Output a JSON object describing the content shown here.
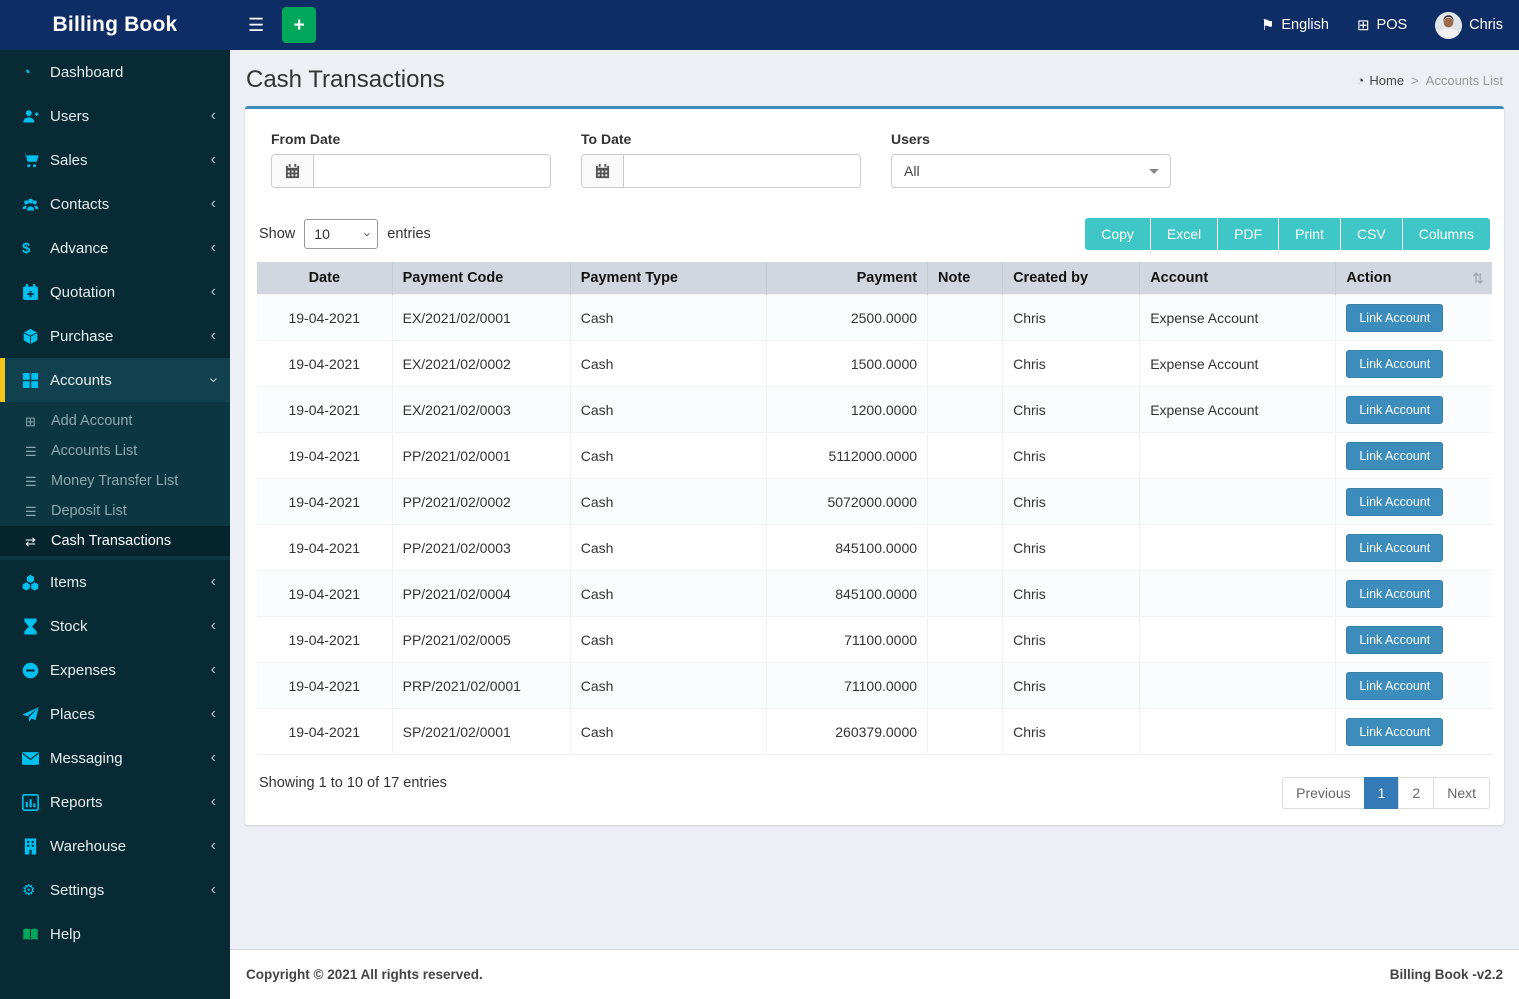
{
  "navbar": {
    "brand": "Billing Book",
    "language": "English",
    "pos": "POS",
    "user": "Chris"
  },
  "page": {
    "title": "Cash Transactions"
  },
  "breadcrumb": {
    "home": "Home",
    "current": "Accounts List"
  },
  "sidebar": {
    "items": [
      {
        "label": "Dashboard",
        "icon": "dashboard-icon"
      },
      {
        "label": "Users",
        "icon": "user-plus-icon",
        "expandable": true
      },
      {
        "label": "Sales",
        "icon": "cart-icon",
        "expandable": true
      },
      {
        "label": "Contacts",
        "icon": "contacts-icon",
        "expandable": true
      },
      {
        "label": "Advance",
        "icon": "dollar-icon",
        "expandable": true
      },
      {
        "label": "Quotation",
        "icon": "calendar-plus-icon",
        "expandable": true
      },
      {
        "label": "Purchase",
        "icon": "cube-icon",
        "expandable": true
      },
      {
        "label": "Accounts",
        "icon": "grid-icon",
        "expandable": true,
        "expanded": true,
        "active": true,
        "children": [
          {
            "label": "Add Account",
            "icon": "plus-square-icon"
          },
          {
            "label": "Accounts List",
            "icon": "list-icon"
          },
          {
            "label": "Money Transfer List",
            "icon": "list-icon"
          },
          {
            "label": "Deposit List",
            "icon": "list-icon"
          },
          {
            "label": "Cash Transactions",
            "icon": "exchange-icon",
            "active": true
          }
        ]
      },
      {
        "label": "Items",
        "icon": "cubes-icon",
        "expandable": true
      },
      {
        "label": "Stock",
        "icon": "hourglass-icon",
        "expandable": true
      },
      {
        "label": "Expenses",
        "icon": "minus-circle-icon",
        "expandable": true
      },
      {
        "label": "Places",
        "icon": "paper-plane-icon",
        "expandable": true
      },
      {
        "label": "Messaging",
        "icon": "envelope-icon",
        "expandable": true
      },
      {
        "label": "Reports",
        "icon": "bar-chart-icon",
        "expandable": true
      },
      {
        "label": "Warehouse",
        "icon": "building-icon",
        "expandable": true
      },
      {
        "label": "Settings",
        "icon": "gears-icon",
        "expandable": true
      },
      {
        "label": "Help",
        "icon": "book-icon"
      }
    ]
  },
  "filters": {
    "from_date": {
      "label": "From Date",
      "value": ""
    },
    "to_date": {
      "label": "To Date",
      "value": ""
    },
    "users": {
      "label": "Users",
      "value": "All"
    }
  },
  "table_controls": {
    "show_label": "Show",
    "page_length": "10",
    "entries_label": "entries",
    "buttons": [
      "Copy",
      "Excel",
      "PDF",
      "Print",
      "CSV",
      "Columns"
    ]
  },
  "table": {
    "columns": [
      "Date",
      "Payment Code",
      "Payment Type",
      "Payment",
      "Note",
      "Created by",
      "Account",
      "Action"
    ],
    "action_label": "Link Account",
    "rows": [
      {
        "date": "19-04-2021",
        "code": "EX/2021/02/0001",
        "type": "Cash",
        "payment": "2500.0000",
        "note": "",
        "created_by": "Chris",
        "account": "Expense Account"
      },
      {
        "date": "19-04-2021",
        "code": "EX/2021/02/0002",
        "type": "Cash",
        "payment": "1500.0000",
        "note": "",
        "created_by": "Chris",
        "account": "Expense Account"
      },
      {
        "date": "19-04-2021",
        "code": "EX/2021/02/0003",
        "type": "Cash",
        "payment": "1200.0000",
        "note": "",
        "created_by": "Chris",
        "account": "Expense Account"
      },
      {
        "date": "19-04-2021",
        "code": "PP/2021/02/0001",
        "type": "Cash",
        "payment": "5112000.0000",
        "note": "",
        "created_by": "Chris",
        "account": ""
      },
      {
        "date": "19-04-2021",
        "code": "PP/2021/02/0002",
        "type": "Cash",
        "payment": "5072000.0000",
        "note": "",
        "created_by": "Chris",
        "account": ""
      },
      {
        "date": "19-04-2021",
        "code": "PP/2021/02/0003",
        "type": "Cash",
        "payment": "845100.0000",
        "note": "",
        "created_by": "Chris",
        "account": ""
      },
      {
        "date": "19-04-2021",
        "code": "PP/2021/02/0004",
        "type": "Cash",
        "payment": "845100.0000",
        "note": "",
        "created_by": "Chris",
        "account": ""
      },
      {
        "date": "19-04-2021",
        "code": "PP/2021/02/0005",
        "type": "Cash",
        "payment": "71100.0000",
        "note": "",
        "created_by": "Chris",
        "account": ""
      },
      {
        "date": "19-04-2021",
        "code": "PRP/2021/02/0001",
        "type": "Cash",
        "payment": "71100.0000",
        "note": "",
        "created_by": "Chris",
        "account": ""
      },
      {
        "date": "19-04-2021",
        "code": "SP/2021/02/0001",
        "type": "Cash",
        "payment": "260379.0000",
        "note": "",
        "created_by": "Chris",
        "account": ""
      }
    ]
  },
  "pagination": {
    "summary": "Showing 1 to 10 of 17 entries",
    "previous": "Previous",
    "pages": [
      "1",
      "2"
    ],
    "active_page": "1",
    "next": "Next"
  },
  "footer": {
    "copyright": "Copyright © 2021 All rights reserved.",
    "version": "Billing Book -v2.2"
  },
  "colors": {
    "navbar": "#0e2d64",
    "sidebar": "#072a35",
    "sidebar_icon_cyan": "#00c0ef",
    "active_highlight_yellow": "#f3c51c",
    "add_button_green": "#00a65a",
    "card_top_border_blue": "#3c8dbc",
    "export_button_teal": "#3fc6c6",
    "link_button_blue": "#3c8dbc",
    "pagination_active_blue": "#337ab7",
    "table_header_gray": "#d2d6de",
    "content_background": "#ecf0f5"
  }
}
